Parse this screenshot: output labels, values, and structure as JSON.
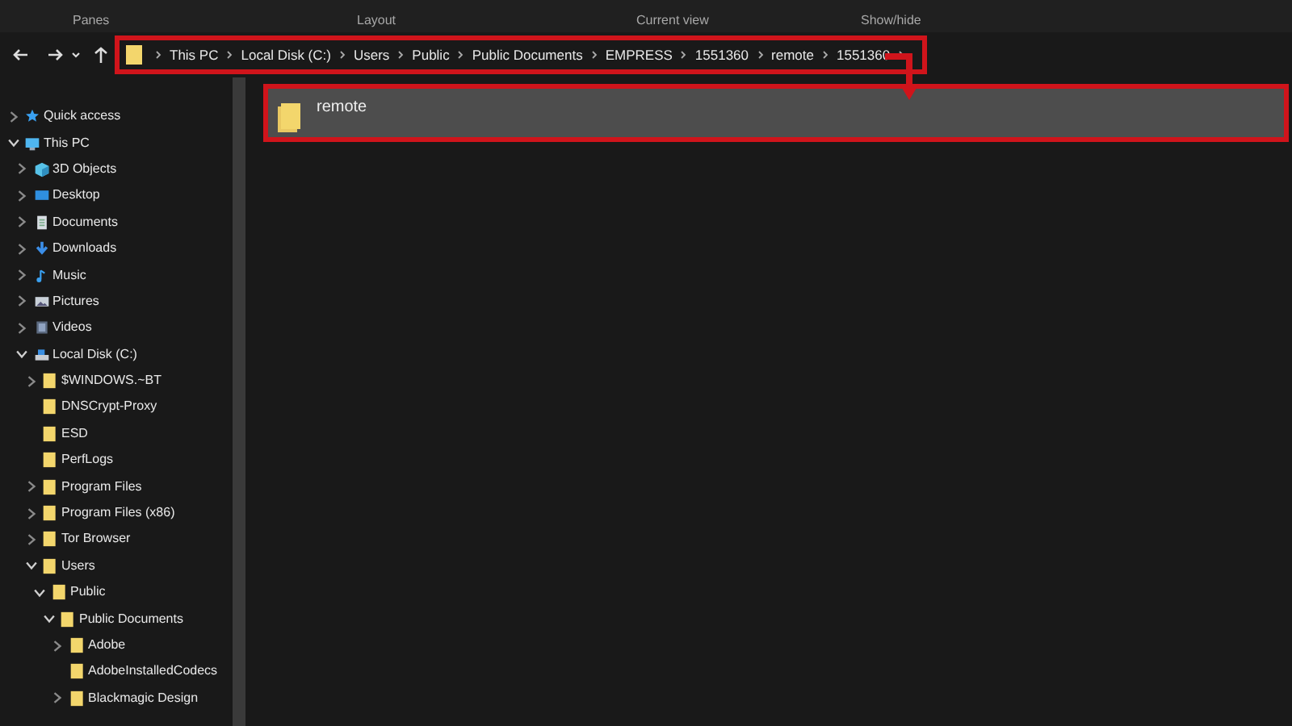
{
  "ribbon": {
    "groups": [
      "Panes",
      "Layout",
      "Current view",
      "Show/hide"
    ]
  },
  "address_bar": {
    "crumbs": [
      "This PC",
      "Local Disk (C:)",
      "Users",
      "Public",
      "Public Documents",
      "EMPRESS",
      "1551360",
      "remote",
      "1551360"
    ]
  },
  "sidebar": {
    "items": [
      {
        "label": "Quick access",
        "kind": "star",
        "expandable": true,
        "expanded": false
      },
      {
        "label": "This PC",
        "kind": "monitor",
        "expandable": true,
        "expanded": true,
        "children": [
          {
            "label": "3D Objects",
            "kind": "cube",
            "expandable": true,
            "expanded": false
          },
          {
            "label": "Desktop",
            "kind": "desktop",
            "expandable": true,
            "expanded": false
          },
          {
            "label": "Documents",
            "kind": "document",
            "expandable": true,
            "expanded": false
          },
          {
            "label": "Downloads",
            "kind": "download",
            "expandable": true,
            "expanded": false
          },
          {
            "label": "Music",
            "kind": "music",
            "expandable": true,
            "expanded": false
          },
          {
            "label": "Pictures",
            "kind": "picture",
            "expandable": true,
            "expanded": false
          },
          {
            "label": "Videos",
            "kind": "video",
            "expandable": true,
            "expanded": false
          },
          {
            "label": "Local Disk (C:)",
            "kind": "drive",
            "expandable": true,
            "expanded": true,
            "children": [
              {
                "label": "$WINDOWS.~BT",
                "kind": "folder",
                "expandable": true,
                "expanded": false
              },
              {
                "label": "DNSCrypt-Proxy",
                "kind": "folder",
                "expandable": false
              },
              {
                "label": "ESD",
                "kind": "folder",
                "expandable": false
              },
              {
                "label": "PerfLogs",
                "kind": "folder",
                "expandable": false
              },
              {
                "label": "Program Files",
                "kind": "folder",
                "expandable": true,
                "expanded": false
              },
              {
                "label": "Program Files (x86)",
                "kind": "folder",
                "expandable": true,
                "expanded": false
              },
              {
                "label": "Tor Browser",
                "kind": "folder",
                "expandable": true,
                "expanded": false
              },
              {
                "label": "Users",
                "kind": "folder",
                "expandable": true,
                "expanded": true,
                "children": [
                  {
                    "label": "Public",
                    "kind": "folder",
                    "expandable": true,
                    "expanded": true,
                    "children": [
                      {
                        "label": "Public Documents",
                        "kind": "folder",
                        "expandable": true,
                        "expanded": true,
                        "children": [
                          {
                            "label": "Adobe",
                            "kind": "folder",
                            "expandable": true,
                            "expanded": false
                          },
                          {
                            "label": "AdobeInstalledCodecs",
                            "kind": "folder",
                            "expandable": false
                          },
                          {
                            "label": "Blackmagic Design",
                            "kind": "folder",
                            "expandable": true,
                            "expanded": false
                          }
                        ]
                      }
                    ]
                  }
                ]
              }
            ]
          }
        ]
      }
    ]
  },
  "files": [
    {
      "name": "remote",
      "selected": true
    }
  ]
}
